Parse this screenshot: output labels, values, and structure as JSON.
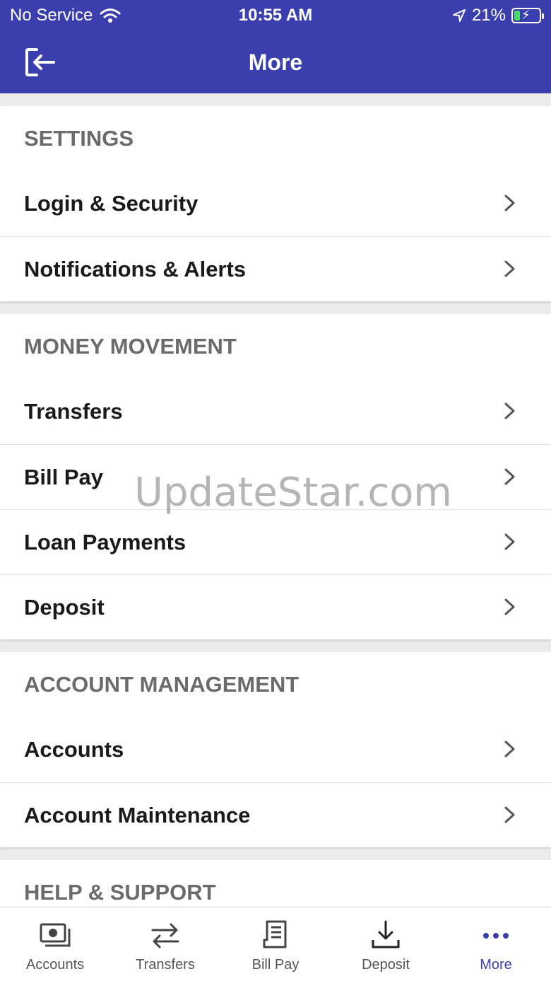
{
  "status_bar": {
    "carrier": "No Service",
    "time": "10:55 AM",
    "battery": "21%"
  },
  "nav": {
    "title": "More"
  },
  "sections": [
    {
      "title": "SETTINGS",
      "items": [
        "Login & Security",
        "Notifications & Alerts"
      ]
    },
    {
      "title": "MONEY MOVEMENT",
      "items": [
        "Transfers",
        "Bill Pay",
        "Loan Payments",
        "Deposit"
      ]
    },
    {
      "title": "ACCOUNT MANAGEMENT",
      "items": [
        "Accounts",
        "Account Maintenance"
      ]
    },
    {
      "title": "HELP & SUPPORT",
      "items": []
    }
  ],
  "watermark": "UpdateStar.com",
  "tabs": [
    {
      "label": "Accounts",
      "icon": "cash-icon"
    },
    {
      "label": "Transfers",
      "icon": "transfer-arrows-icon"
    },
    {
      "label": "Bill Pay",
      "icon": "receipt-icon"
    },
    {
      "label": "Deposit",
      "icon": "download-icon"
    },
    {
      "label": "More",
      "icon": "more-dots-icon"
    }
  ],
  "colors": {
    "primary": "#3b3fae",
    "section_title": "#6b6b6b",
    "background": "#ececec"
  }
}
